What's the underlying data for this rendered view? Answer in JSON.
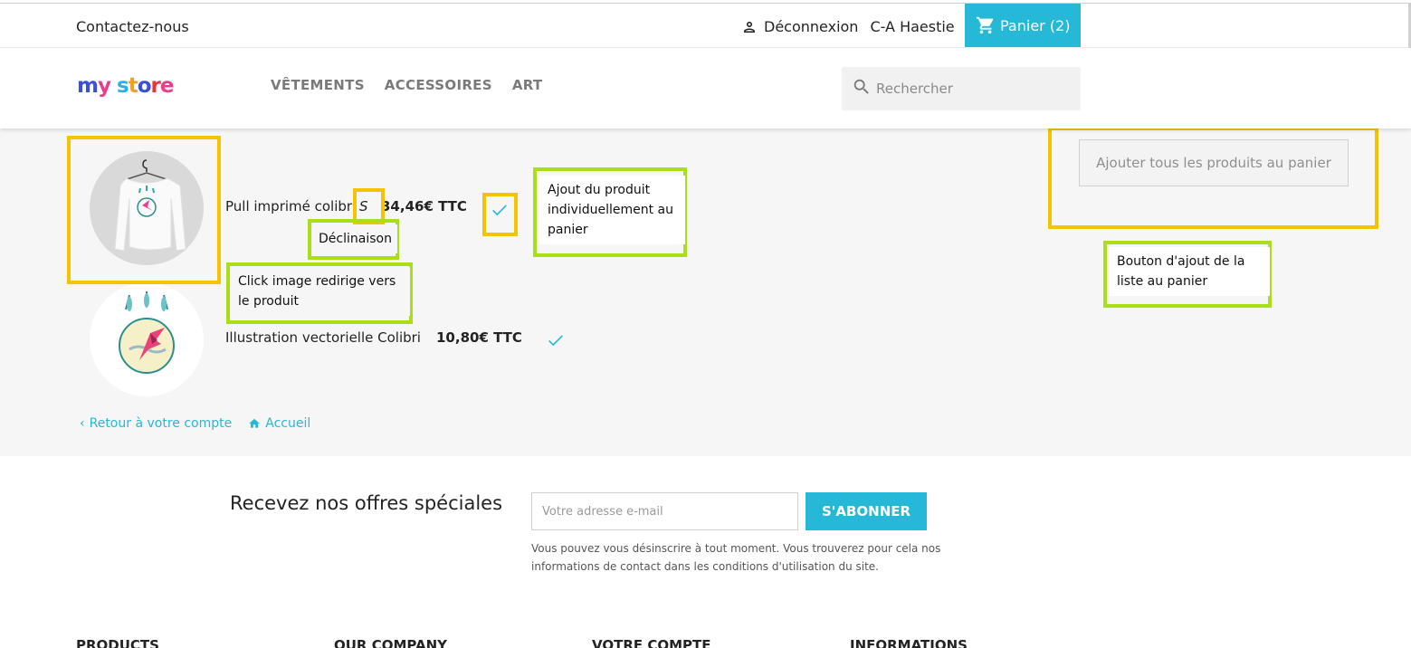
{
  "topbar": {
    "contact": "Contactez-nous",
    "logout": "Déconnexion",
    "user_name": "C-A Haestie",
    "cart_label": "Panier",
    "cart_count": "(2)"
  },
  "header": {
    "logo": {
      "part1": "my",
      "part2": "store",
      "colors": [
        "#e83e8c",
        "#3a4ee0",
        "#2ab0e8",
        "#f3a01d",
        "#e8343e"
      ]
    },
    "nav": [
      "VÊTEMENTS",
      "ACCESSOIRES",
      "ART"
    ],
    "search_placeholder": "Rechercher"
  },
  "wishlist": {
    "products": [
      {
        "name": "Pull imprimé colibri",
        "variant": "S",
        "price": "34,46€ TTC",
        "image": "sweater-hummingbird"
      },
      {
        "name": "Illustration vectorielle Colibri",
        "variant": "",
        "price": "10,80€ TTC",
        "image": "hummingbird-illustration"
      }
    ],
    "add_all_button": "Ajouter tous les produits au panier",
    "links": {
      "back_account": "Retour à votre compte",
      "home": "Accueil"
    }
  },
  "annotations": {
    "variant": "Déclinaison",
    "image_click": "Click image redirige vers le produit",
    "add_single": "Ajout du produit individuellement au panier",
    "add_list": "Bouton d'ajout de la liste au panier"
  },
  "newsletter": {
    "title": "Recevez nos offres spéciales",
    "email_placeholder": "Votre adresse e-mail",
    "subscribe": "S'ABONNER",
    "note": "Vous pouvez vous désinscrire à tout moment. Vous trouverez pour cela nos informations de contact dans les conditions d'utilisation du site."
  },
  "footer": {
    "columns": [
      "PRODUCTS",
      "OUR COMPANY",
      "VOTRE COMPTE",
      "INFORMATIONS"
    ]
  },
  "colors": {
    "accent": "#25b9d7",
    "highlight_yellow": "#f5c300",
    "highlight_green": "#a8df17",
    "main_bg": "#f6f6f6"
  }
}
